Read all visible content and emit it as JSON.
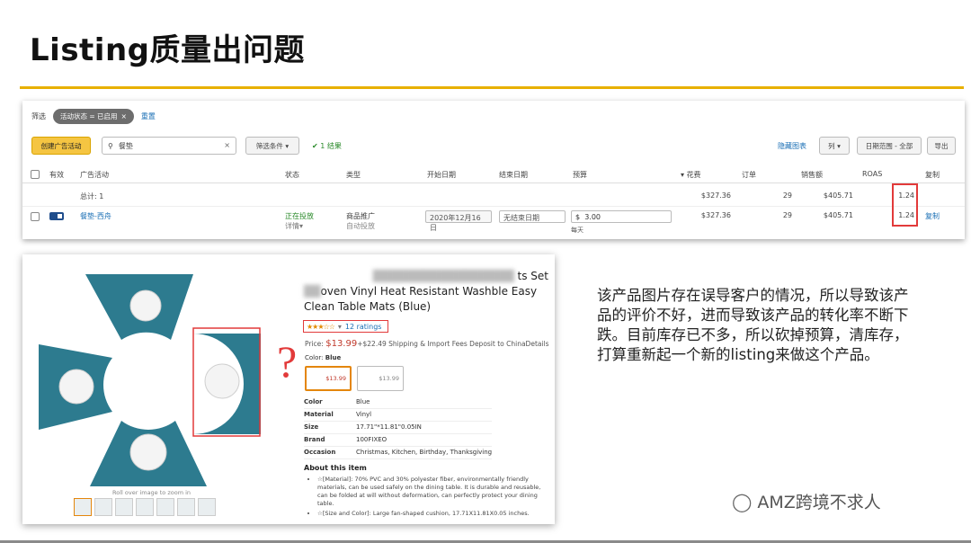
{
  "slide": {
    "title": "Listing质量出问题",
    "description": "该产品图片存在误导客户的情况，所以导致该产品的评价不好，进而导致该产品的转化率不断下跌。目前库存已不多，所以砍掉预算，清库存，打算重新起一个新的listing来做这个产品。",
    "watermark": "AMZ跨境不求人",
    "accent_color": "#e8b000"
  },
  "ads": {
    "filter_label": "筛选",
    "filter_chip": "活动状态 = 已启用",
    "reset_label": "重置",
    "create_button": "创建广告活动",
    "search_value": "餐垫",
    "filter_button": "筛选条件",
    "result_text": "1 结果",
    "hide_chart": "隐藏图表",
    "columns_button": "列",
    "date_range_button": "日期范围 - 全部",
    "export_button": "导出",
    "headers": {
      "active": "有效",
      "campaign": "广告活动",
      "status": "状态",
      "type": "类型",
      "start": "开始日期",
      "end": "结束日期",
      "budget": "预算",
      "spend": "花费",
      "orders": "订单",
      "sales": "销售额",
      "roas": "ROAS",
      "copy": "复制"
    },
    "total": {
      "label": "总计: 1",
      "spend": "$327.36",
      "orders": "29",
      "sales": "$405.71",
      "roas": "1.24"
    },
    "row": {
      "campaign": "餐垫-西舟",
      "status": "正在投放",
      "status_sub": "详情",
      "type": "商品推广",
      "type_sub": "自动投放",
      "start": "2020年12月16日",
      "end": "无结束日期",
      "budget_currency": "$",
      "budget": "3.00",
      "budget_sub": "每天",
      "spend": "$327.36",
      "orders": "29",
      "sales": "$405.71",
      "roas": "1.24",
      "copy": "复制"
    },
    "status_color": "#2a8a2a"
  },
  "product": {
    "title_blurred": "ts Set",
    "title_line2": "oven Vinyl Heat Resistant Washble Easy",
    "title_line3": "Clean Table Mats (Blue)",
    "rating_count": "12 ratings",
    "price_label": "Price:",
    "price": "$13.99",
    "shipping": "+$22.49 Shipping & Import Fees Deposit to ChinaDetails",
    "color_label": "Color:",
    "color_value": "Blue",
    "swatch1_price": "$13.99",
    "swatch2_price": "$13.99",
    "attributes": [
      {
        "k": "Color",
        "v": "Blue"
      },
      {
        "k": "Material",
        "v": "Vinyl"
      },
      {
        "k": "Size",
        "v": "17.71\"*11.81\"0.05IN"
      },
      {
        "k": "Brand",
        "v": "100FIXEO"
      },
      {
        "k": "Occasion",
        "v": "Christmas, Kitchen, Birthday, Thanksgiving"
      }
    ],
    "about_heading": "About this item",
    "about_1": "☆[Material]: 70% PVC and 30% polyester fiber, environmentally friendly materials, can be used safely on the dining table. It is durable and reusable, can be folded at will without deformation, can perfectly protect your dining table.",
    "about_2": "☆[Size and Color]: Large fan-shaped cushion, 17.71X11.81X0.05 inches.",
    "rollover": "Roll over image to zoom in",
    "mat_color": "#2d7b8f",
    "question_mark": "?"
  }
}
